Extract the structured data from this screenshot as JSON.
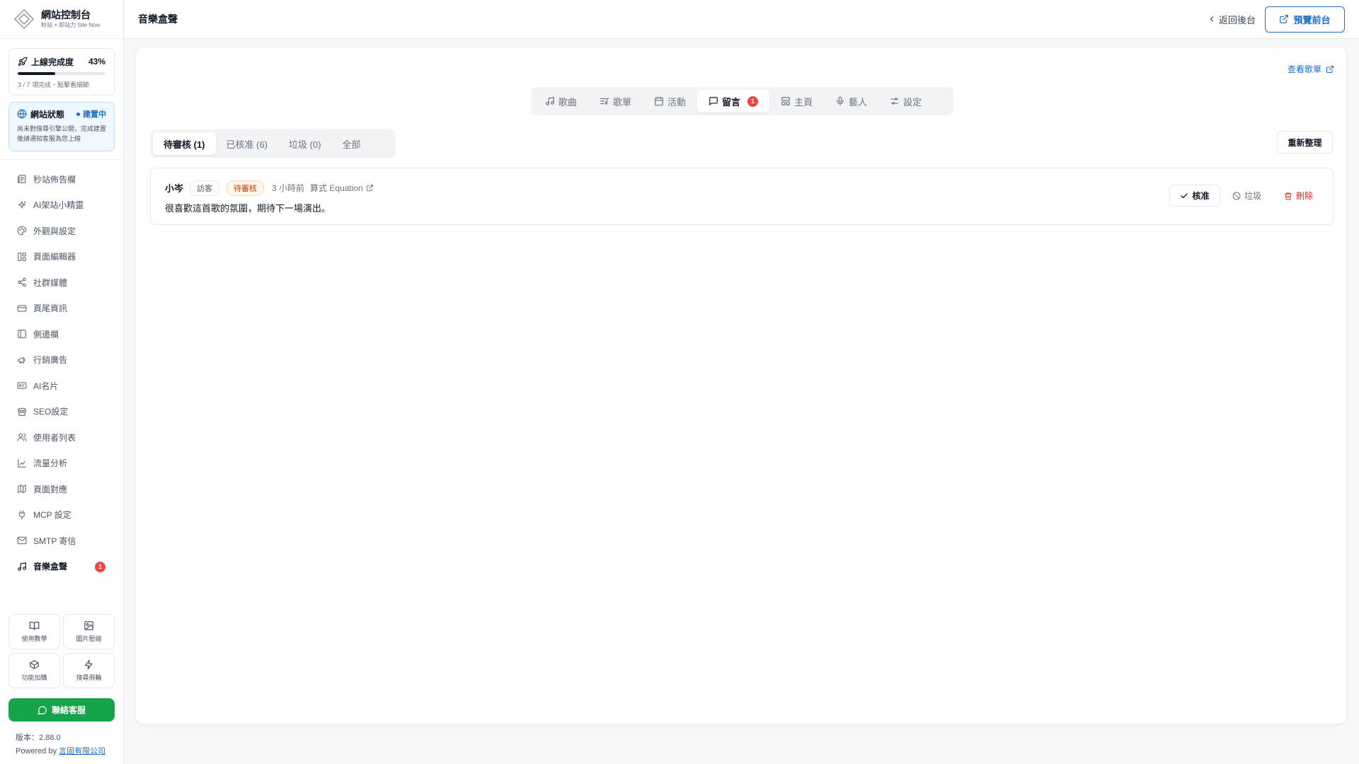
{
  "brand": {
    "title": "網站控制台",
    "subtitle": "秒站 × 即站力 Site Now"
  },
  "progress": {
    "label": "上線完成度",
    "percent_text": "43%",
    "fraction": 0.43,
    "note": "3 / 7 項完成・點擊看細節"
  },
  "site_status": {
    "label": "網站狀態",
    "badge": "建置中",
    "note": "尚未對搜尋引擎公開，完成建置後請通知客服為您上線",
    "accent": "#1d6fc6"
  },
  "sidebar": {
    "items": [
      {
        "label": "秒站佈告欄",
        "icon": "newspaper-icon"
      },
      {
        "label": "AI架站小精靈",
        "icon": "sparkles-icon"
      },
      {
        "label": "外觀與設定",
        "icon": "palette-icon"
      },
      {
        "label": "頁面編輯器",
        "icon": "layout-icon"
      },
      {
        "label": "社群媒體",
        "icon": "share-icon"
      },
      {
        "label": "頁尾資訊",
        "icon": "card-icon"
      },
      {
        "label": "側邊欄",
        "icon": "panel-left-icon"
      },
      {
        "label": "行銷廣告",
        "icon": "megaphone-icon"
      },
      {
        "label": "AI名片",
        "icon": "id-card-icon"
      },
      {
        "label": "SEO設定",
        "icon": "store-icon"
      },
      {
        "label": "使用者列表",
        "icon": "users-icon"
      },
      {
        "label": "流量分析",
        "icon": "chart-line-icon"
      },
      {
        "label": "頁面對應",
        "icon": "map-icon"
      },
      {
        "label": "MCP 設定",
        "icon": "plug-icon"
      },
      {
        "label": "SMTP 寄信",
        "icon": "mail-icon"
      },
      {
        "label": "音樂盒聲",
        "icon": "music-icon",
        "badge": "1",
        "active": true
      }
    ]
  },
  "tools": [
    {
      "label": "使用教學",
      "icon": "book-icon"
    },
    {
      "label": "圖片壓縮",
      "icon": "image-icon"
    },
    {
      "label": "功能加購",
      "icon": "package-icon"
    },
    {
      "label": "搜尋飛輪",
      "icon": "zap-icon"
    }
  ],
  "support": {
    "label": "聯絡客服",
    "color": "#16a34a"
  },
  "footer": {
    "version": "版本：2.88.0",
    "powered_prefix": "Powered by ",
    "company": "言固有限公司"
  },
  "header": {
    "title": "音樂盒聲",
    "back_label": "返回後台",
    "preview_label": "預覽前台"
  },
  "main": {
    "view_list_label": "查看歌單",
    "tabs": [
      {
        "label": "歌曲",
        "icon": "music-icon"
      },
      {
        "label": "歌單",
        "icon": "list-music-icon"
      },
      {
        "label": "活動",
        "icon": "calendar-icon"
      },
      {
        "label": "留言",
        "icon": "message-icon",
        "badge": "1",
        "active": true
      },
      {
        "label": "主頁",
        "icon": "layout-icon"
      },
      {
        "label": "藝人",
        "icon": "mic-icon"
      },
      {
        "label": "設定",
        "icon": "sliders-icon"
      }
    ],
    "filters": [
      {
        "label": "待審核 (1)",
        "active": true
      },
      {
        "label": "已核准 (6)"
      },
      {
        "label": "垃圾 (0)"
      },
      {
        "label": "全部"
      }
    ],
    "refresh_label": "重新整理",
    "comments": [
      {
        "author": "小岑",
        "role": "訪客",
        "status": "待審核",
        "time": "3 小時前",
        "song": "算式 Equation",
        "body": "很喜歡這首歌的氛圍，期待下一場演出。",
        "actions": {
          "approve": "核准",
          "spam": "垃圾",
          "delete": "刪除"
        }
      }
    ]
  }
}
